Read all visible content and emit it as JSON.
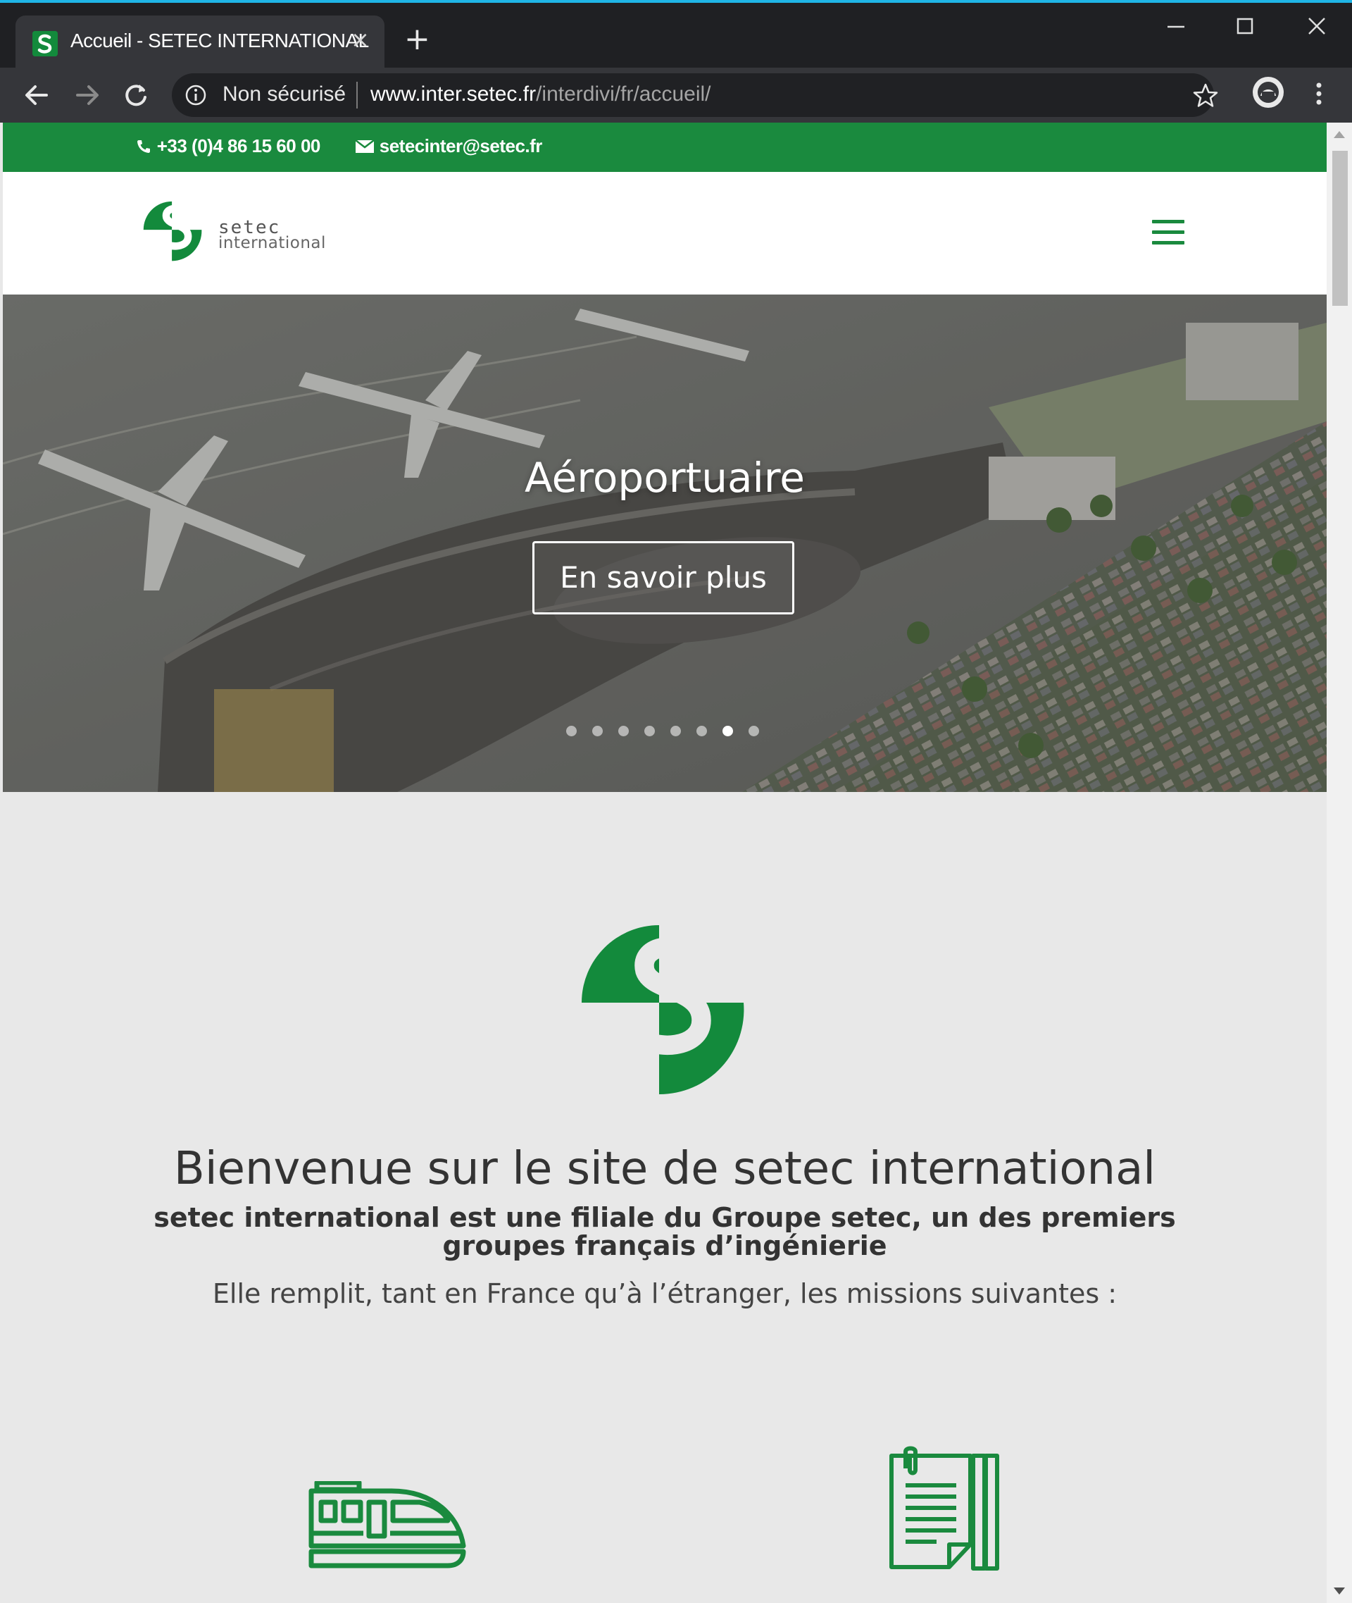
{
  "browser": {
    "tab_title": "Accueil - SETEC INTERNATIONAL",
    "tab_close": "×",
    "new_tab": "+",
    "security_label": "Non sécurisé",
    "url_host": "www.inter.setec.fr",
    "url_path": "/interdivi/fr/accueil/",
    "icons": [
      "back-icon",
      "forward-icon",
      "reload-icon",
      "info-icon",
      "star-icon",
      "profile-icon",
      "menu-icon",
      "minimize-icon",
      "maximize-icon",
      "close-icon"
    ]
  },
  "topbar": {
    "phone": "+33 (0)4 86 15 60 00",
    "email": "setecinter@setec.fr",
    "color": "#1a8a3e"
  },
  "header": {
    "logo_line1": "setec",
    "logo_line2": "international"
  },
  "hero": {
    "title": "Aéroportuaire",
    "button_label": "En savoir plus",
    "slide_count": 8,
    "active_slide": 7
  },
  "welcome": {
    "title": "Bienvenue sur le site de setec international",
    "subtitle": "setec international est une filiale du Groupe setec, un des premiers groupes français d’ingénierie",
    "text": "Elle remplit, tant en France qu’à l’étranger, les missions suivantes :"
  },
  "brand_color": "#138a3c"
}
